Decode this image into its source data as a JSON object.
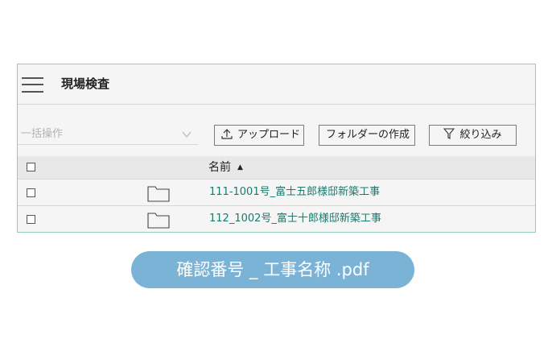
{
  "header": {
    "title": "現場検査",
    "menu_icon": "hamburger-icon"
  },
  "toolbar": {
    "bulk_action_placeholder": "一括操作",
    "upload_label": "アップロード",
    "create_folder_label": "フォルダーの作成",
    "filter_label": "絞り込み"
  },
  "table": {
    "columns": {
      "name": "名前",
      "sort_indicator": "▲"
    },
    "rows": [
      {
        "name": "111-1001号_富士五郎様邸新築工事",
        "icon": "folder-icon"
      },
      {
        "name": "112_1002号_富士十郎様邸新築工事",
        "icon": "folder-icon"
      }
    ]
  },
  "caption": {
    "text": "確認番号 _ 工事名称 .pdf"
  },
  "colors": {
    "panel_border": "#8fcfb8",
    "link": "#1a7a6e",
    "pill_background": "#7ab3d6"
  }
}
